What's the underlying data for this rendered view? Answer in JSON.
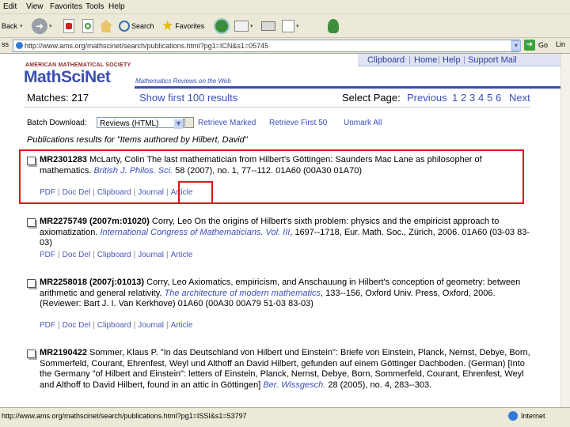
{
  "menu": [
    "Edit",
    "View",
    "Favorites",
    "Tools",
    "Help"
  ],
  "toolbar": {
    "back": "Back",
    "search": "Search",
    "favorites": "Favorites"
  },
  "address": {
    "url": "http://www.ams.org/mathscinet/search/publications.html?pg1=ICN&s1=05745",
    "go": "Go",
    "links": "Lin"
  },
  "site": {
    "org": "AMERICAN MATHEMATICAL SOCIETY",
    "logo": "MathSciNet",
    "tagline": "Mathematics Reviews on the Web",
    "nav": [
      "Clipboard",
      "Home",
      "Help",
      "Support Mail"
    ]
  },
  "matches": {
    "label": "Matches: 217",
    "show_first": "Show first 100 results",
    "select_page": "Select Page:",
    "previous": "Previous",
    "pages": [
      "1",
      "2",
      "3",
      "4",
      "5",
      "6"
    ],
    "next": "Next"
  },
  "batch": {
    "label": "Batch Download:",
    "format": "Reviews (HTML)",
    "retrieve_marked": "Retrieve Marked",
    "retrieve_first": "Retrieve First 50",
    "unmark": "Unmark All"
  },
  "results_heading": "Publications results for \"Items authored by Hilbert, David\"",
  "results": [
    {
      "mr": "MR2301283",
      "text_a": " McLarty, Colin The last mathematician from Hilbert's Göttingen: Saunders Mac Lane as philosopher of mathematics. ",
      "journal": "British J. Philos. Sci.",
      "text_b": " 58 (2007), no. 1, 77--112. 01A60 (00A30 01A70)",
      "links": [
        "PDF",
        "Doc Del",
        "Clipboard",
        "Journal",
        "Article"
      ]
    },
    {
      "mr": "MR2275749 (2007m:01020)",
      "text_a": " Corry, Leo On the origins of Hilbert's sixth problem: physics and the empiricist approach to axiomatization. ",
      "journal": "International Congress of Mathematicians. Vol. III",
      "text_b": ", 1697--1718, Eur. Math. Soc., Zürich, 2006. 01A60 (03-03 83-03)",
      "links": [
        "PDF",
        "Doc Del",
        "Clipboard",
        "Journal",
        "Article"
      ]
    },
    {
      "mr": "MR2258018 (2007j:01013)",
      "text_a": " Corry, Leo Axiomatics, empiricism, and Anschauung in Hilbert's conception of geometry: between arithmetic and general relativity. ",
      "journal": "The architecture of modern mathematics",
      "text_b": ", 133--156, Oxford Univ. Press, Oxford, 2006. (Reviewer: Bart J. I. Van Kerkhove) 01A60 (00A30 00A79 51-03 83-03)",
      "links": [
        "PDF",
        "Doc Del",
        "Clipboard",
        "Journal",
        "Article"
      ]
    },
    {
      "mr": "MR2190422",
      "text_a": " Sommer, Klaus P. \"In das Deutschland von Hilbert und Einstein\": Briefe von Einstein, Planck, Nernst, Debye, Born, Sommerfeld, Courant, Ehrenfest, Weyl und Althoff an David Hilbert, gefunden auf einem Göttinger Dachboden. (German) [Into the Germany \"of Hilbert and Einstein\": letters of Einstein, Planck, Nernst, Debye, Born, Sommerfeld, Courant, Ehrenfest, Weyl and Althoff to David Hilbert, found in an attic in Göttingen] ",
      "journal": "Ber. Wissgesch.",
      "text_b": " 28 (2005), no. 4, 283--303.",
      "links": []
    }
  ],
  "status": {
    "url": "http://www.ams.org/mathscinet/search/publications.html?pg1=ISSI&s1=53797",
    "zone": "Internet"
  },
  "colors": {
    "highlight": "#e0141b",
    "link": "#3b4fb8",
    "logo": "#3a4fb0"
  }
}
